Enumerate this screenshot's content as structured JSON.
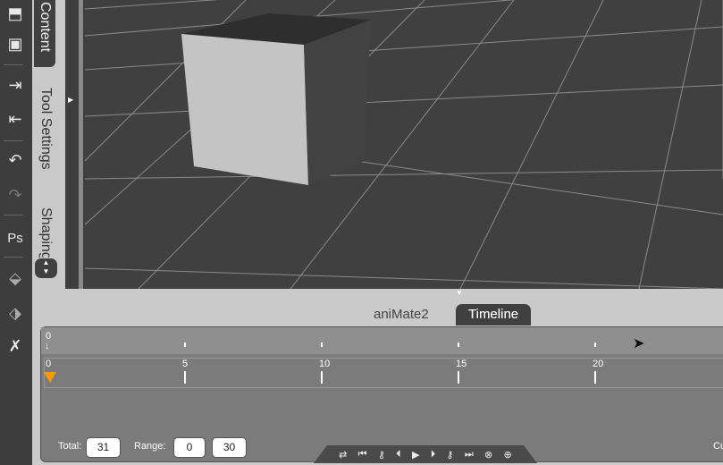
{
  "toolbar": {
    "items": [
      {
        "icon": "open-folder-icon",
        "glyph": "📂"
      },
      {
        "icon": "save-icon",
        "glyph": "💾"
      },
      {
        "icon": "import-icon",
        "glyph": "⇲"
      },
      {
        "icon": "export-icon",
        "glyph": "⇱"
      },
      {
        "icon": "undo-icon",
        "glyph": "↶"
      },
      {
        "icon": "redo-icon",
        "glyph": "↷"
      },
      {
        "icon": "photoshop-bridge-icon",
        "glyph": "Ps"
      },
      {
        "icon": "send-to-3d-icon",
        "glyph": "⬇"
      },
      {
        "icon": "send-to-book-icon",
        "glyph": "⬇"
      },
      {
        "icon": "zbrush-bridge-icon",
        "glyph": "⬇"
      }
    ]
  },
  "side_tabs": {
    "content": "Content",
    "tool_settings": "Tool Settings",
    "shaping": "Shaping"
  },
  "panel_tabs": {
    "animate": "aniMate2",
    "timeline": "Timeline",
    "active": "Timeline"
  },
  "timeline": {
    "top_ruler_label": "0",
    "ruler_labels": [
      "0",
      "5",
      "10",
      "15",
      "20"
    ],
    "current_frame": 0,
    "total_label": "Total:",
    "total": "31",
    "range_label": "Range:",
    "range_start": "0",
    "range_end": "30",
    "current_label": "Cu",
    "accent": "#ff9900",
    "transport": [
      "loop-icon",
      "jump-start-icon",
      "prev-key-icon",
      "step-back-icon",
      "play-icon",
      "step-forward-icon",
      "next-key-icon",
      "jump-end-icon",
      "remove-key-icon",
      "add-key-icon"
    ]
  }
}
